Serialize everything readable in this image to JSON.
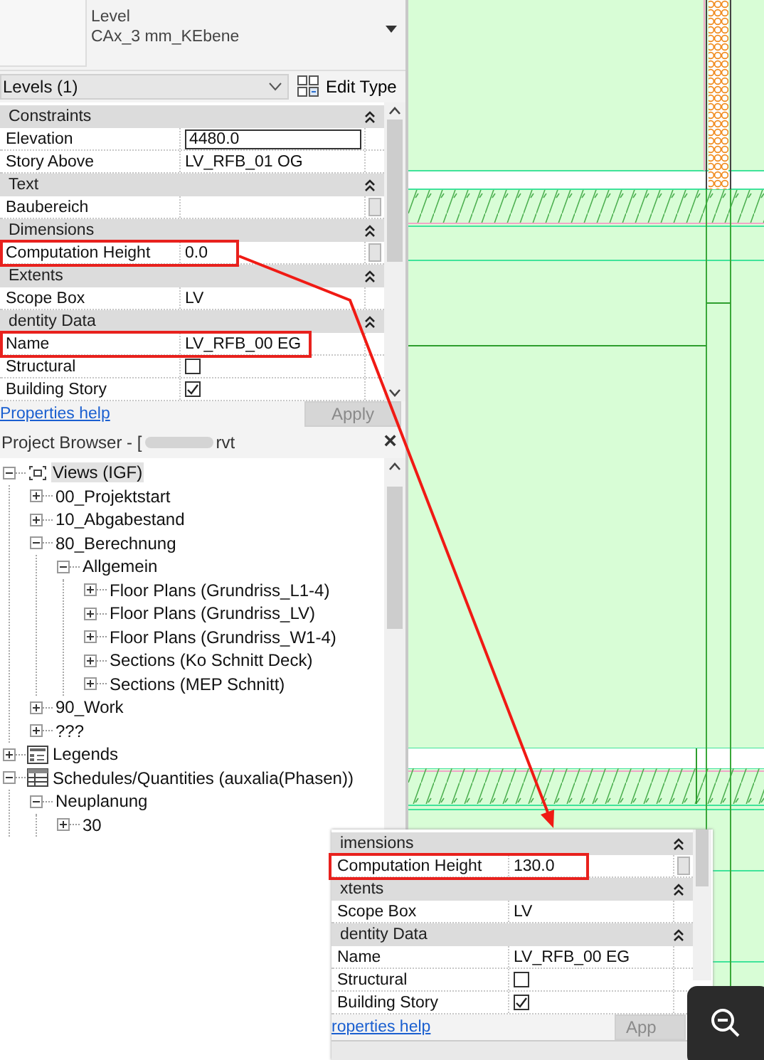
{
  "type_selector": {
    "category": "Level",
    "type": "CAx_3 mm_KEbene"
  },
  "filter": {
    "value": "Levels (1)"
  },
  "edit_type": {
    "label": "Edit Type"
  },
  "properties": [
    {
      "kind": "group",
      "label": "Constraints",
      "expanded": true
    },
    {
      "kind": "field",
      "label": "Elevation",
      "value": "4480.0",
      "editing": true,
      "button": false
    },
    {
      "kind": "field",
      "label": "Story Above",
      "value": "LV_RFB_01 OG",
      "editing": false,
      "button": false
    },
    {
      "kind": "group",
      "label": "Text",
      "expanded": true
    },
    {
      "kind": "field",
      "label": "Baubereich",
      "editing": false,
      "button": true
    },
    {
      "kind": "group",
      "label": "Dimensions",
      "expanded": true
    },
    {
      "kind": "field",
      "label": "Computation Height",
      "value": "0.0",
      "editing": false,
      "button": true
    },
    {
      "kind": "group",
      "label": "Extents",
      "expanded": true
    },
    {
      "kind": "field",
      "label": "Scope Box",
      "value": "LV",
      "editing": false,
      "button": false
    },
    {
      "kind": "group",
      "label": "dentity Data",
      "expanded": true
    },
    {
      "kind": "field",
      "label": "Name",
      "value": "LV_RFB_00 EG",
      "editing": false,
      "button": false
    },
    {
      "kind": "check",
      "label": "Structural",
      "checked": false
    },
    {
      "kind": "check",
      "label": "Building Story",
      "checked": true
    }
  ],
  "properties_help": "Properties help",
  "apply": {
    "label": "Apply",
    "disabled": true
  },
  "browser": {
    "title_start": "Project Browser - [",
    "title_end": "rvt",
    "close": "×",
    "tree": [
      {
        "label": "Views (IGF)",
        "kind": "views",
        "expanded": true,
        "selected": true,
        "children": [
          {
            "label": "00_Projektstart",
            "expanded": false,
            "selected": false
          },
          {
            "label": "10_Abgabestand",
            "expanded": false,
            "selected": false
          },
          {
            "label": "80_Berechnung",
            "expanded": true,
            "selected": false,
            "children": [
              {
                "label": "Allgemein",
                "expanded": true,
                "selected": false,
                "children": [
                  {
                    "label": "Floor Plans (Grundriss_L1-4)",
                    "expanded": false,
                    "selected": false
                  },
                  {
                    "label": "Floor Plans (Grundriss_LV)",
                    "expanded": false,
                    "selected": false
                  },
                  {
                    "label": "Floor Plans (Grundriss_W1-4)",
                    "expanded": false,
                    "selected": false
                  },
                  {
                    "label": "Sections (Ko Schnitt Deck)",
                    "expanded": false,
                    "selected": false
                  },
                  {
                    "label": "Sections (MEP Schnitt)",
                    "expanded": false,
                    "selected": false
                  }
                ]
              }
            ]
          },
          {
            "label": "90_Work",
            "expanded": false,
            "selected": false
          },
          {
            "label": "???",
            "expanded": false,
            "selected": false
          }
        ]
      },
      {
        "label": "Legends",
        "kind": "legends",
        "expanded": false,
        "selected": false
      },
      {
        "label": "Schedules/Quantities (auxalia(Phasen))",
        "kind": "schedules",
        "expanded": true,
        "selected": false,
        "children": [
          {
            "label": "Neuplanung",
            "expanded": true,
            "selected": false,
            "children": [
              {
                "label": "30",
                "expanded": false,
                "selected": false
              }
            ]
          }
        ]
      }
    ]
  },
  "inset": {
    "properties": [
      {
        "kind": "group",
        "label": "imensions",
        "expanded": true
      },
      {
        "kind": "field",
        "label": "Computation Height",
        "value": "130.0",
        "editing": false,
        "button": true
      },
      {
        "kind": "group",
        "label": "xtents",
        "expanded": true
      },
      {
        "kind": "field",
        "label": "Scope Box",
        "value": "LV",
        "editing": false,
        "button": false
      },
      {
        "kind": "group",
        "label": "dentity Data",
        "expanded": true
      },
      {
        "kind": "field",
        "label": "Name",
        "value": "LV_RFB_00 EG",
        "editing": false,
        "button": false
      },
      {
        "kind": "check",
        "label": "Structural",
        "checked": false
      },
      {
        "kind": "check",
        "label": "Building Story",
        "checked": true
      }
    ],
    "help": "roperties help",
    "apply": {
      "label": "App",
      "disabled": true
    }
  }
}
